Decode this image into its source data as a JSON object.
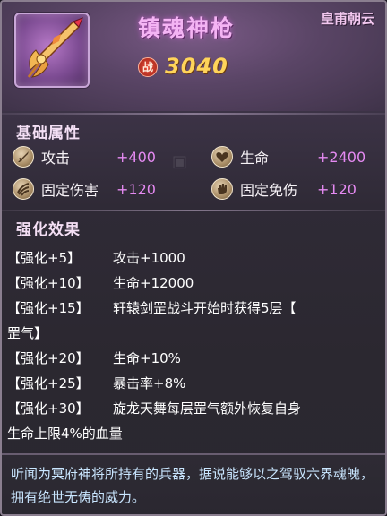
{
  "item": {
    "name": "镇魂神枪",
    "owner": "皇甫朝云",
    "power_badge": "战",
    "power_value": "3040",
    "icon": "spear-weapon-icon"
  },
  "basic_attributes": {
    "title": "基础属性",
    "stats": [
      {
        "label": "攻击",
        "value": "+400",
        "icon": "sword-icon"
      },
      {
        "label": "生命",
        "value": "+2400",
        "icon": "heart-icon"
      },
      {
        "label": "固定伤害",
        "value": "+120",
        "icon": "claw-icon"
      },
      {
        "label": "固定免伤",
        "value": "+120",
        "icon": "palm-icon"
      }
    ]
  },
  "enhance_effects": {
    "title": "强化效果",
    "rows": [
      {
        "tier": "【强化+5】",
        "desc": "攻击+1000"
      },
      {
        "tier": "【强化+10】",
        "desc": "生命+12000"
      },
      {
        "tier": "【强化+15】",
        "desc": "轩辕剑罡战斗开始时获得5层【",
        "cont": "罡气】"
      },
      {
        "tier": "【强化+20】",
        "desc": "生命+10%"
      },
      {
        "tier": "【强化+25】",
        "desc": "暴击率+8%"
      },
      {
        "tier": "【强化+30】",
        "desc": "旋龙天舞每层罡气额外恢复自身",
        "cont": "生命上限4%的血量"
      }
    ]
  },
  "flavor_text": "听闻为冥府神将所持有的兵器，据说能够以之驾驭六界魂魄，拥有绝世无俦的威力。",
  "colors": {
    "stat_value": "#e58af2",
    "name": "#f4b4f4",
    "power": "#ffd45a",
    "flavor": "#c9e6ff"
  }
}
